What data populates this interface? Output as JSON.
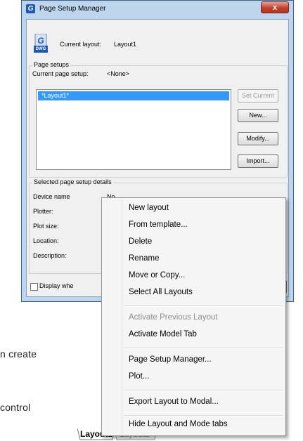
{
  "window": {
    "title": "Page Setup Manager",
    "app_icon_letter": "G",
    "close_label": "x"
  },
  "current_layout": {
    "label": "Current layout:",
    "value": "Layout1",
    "icon_badge": "DWG"
  },
  "page_setups": {
    "group_title": "Page setups",
    "current_label": "Current page setup:",
    "current_value": "<None>",
    "list_items": [
      "*Layout1*"
    ],
    "buttons": {
      "set_current": "Set Current",
      "new": "New...",
      "modify": "Modify...",
      "import": "Import..."
    }
  },
  "details": {
    "group_title": "Selected page setup details",
    "device_name_label": "Device name",
    "device_name_value": "No",
    "plotter_label": "Plotter:",
    "plot_size_label": "Plot size:",
    "location_label": "Location:",
    "description_label": "Description:"
  },
  "footer": {
    "display_checkbox_label": "Display whe"
  },
  "background_text": {
    "line1": "n create",
    "line2": "control"
  },
  "tabs": {
    "layout1": "Layout1",
    "layout2": "Layout2"
  },
  "context_menu": {
    "items": [
      "New layout",
      "From template...",
      "Delete",
      "Rename",
      "Move or Copy...",
      "Select All Layouts",
      "Activate Previous Layout",
      "Activate Model Tab",
      "Page Setup Manager...",
      "Plot...",
      "Export Layout to Modal...",
      "Hide Layout and Mode tabs"
    ]
  }
}
